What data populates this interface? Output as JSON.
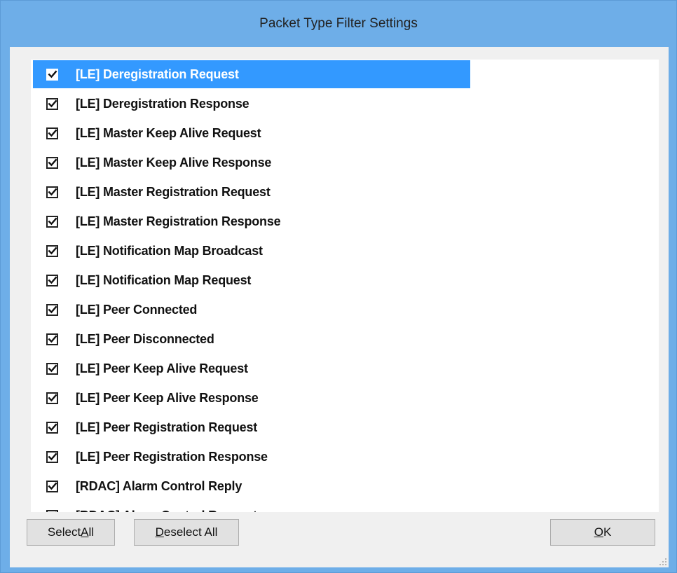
{
  "window": {
    "title": "Packet Type Filter Settings"
  },
  "list": {
    "items": [
      {
        "label": "[LE] Deregistration Request",
        "checked": true,
        "selected": true
      },
      {
        "label": "[LE] Deregistration Response",
        "checked": true,
        "selected": false
      },
      {
        "label": "[LE] Master Keep Alive Request",
        "checked": true,
        "selected": false
      },
      {
        "label": "[LE] Master Keep Alive Response",
        "checked": true,
        "selected": false
      },
      {
        "label": "[LE] Master Registration Request",
        "checked": true,
        "selected": false
      },
      {
        "label": "[LE] Master Registration Response",
        "checked": true,
        "selected": false
      },
      {
        "label": "[LE] Notification Map Broadcast",
        "checked": true,
        "selected": false
      },
      {
        "label": "[LE] Notification Map Request",
        "checked": true,
        "selected": false
      },
      {
        "label": "[LE] Peer Connected",
        "checked": true,
        "selected": false
      },
      {
        "label": "[LE] Peer Disconnected",
        "checked": true,
        "selected": false
      },
      {
        "label": "[LE] Peer Keep Alive Request",
        "checked": true,
        "selected": false
      },
      {
        "label": "[LE] Peer Keep Alive Response",
        "checked": true,
        "selected": false
      },
      {
        "label": "[LE] Peer Registration Request",
        "checked": true,
        "selected": false
      },
      {
        "label": "[LE] Peer Registration Response",
        "checked": true,
        "selected": false
      },
      {
        "label": "[RDAC] Alarm Control Reply",
        "checked": true,
        "selected": false
      },
      {
        "label": "[RDAC] Alarm Control Request",
        "checked": true,
        "selected": false
      }
    ]
  },
  "buttons": {
    "select_all_pre": "Select ",
    "select_all_ul": "A",
    "select_all_post": "ll",
    "deselect_all_pre": "",
    "deselect_all_ul": "D",
    "deselect_all_post": "eselect All",
    "ok_pre": "",
    "ok_ul": "O",
    "ok_post": "K"
  },
  "colors": {
    "title_bar": "#6eaee8",
    "selection": "#3399ff",
    "client_bg": "#f0f0f0"
  }
}
